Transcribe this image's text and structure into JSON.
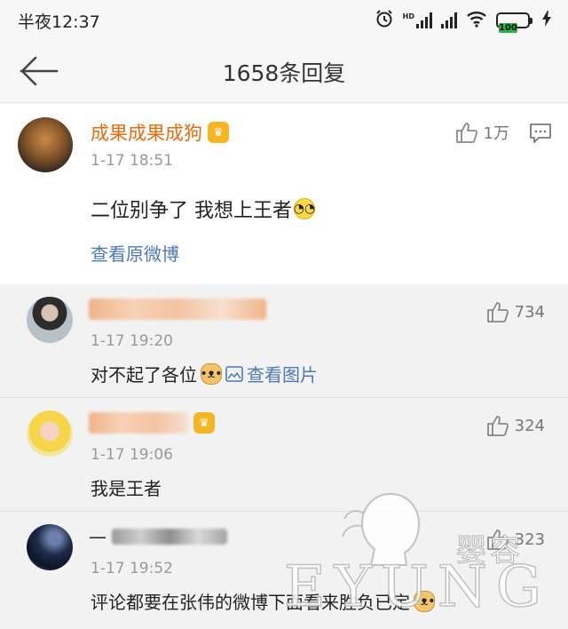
{
  "status_bar": {
    "time": "半夜12:37",
    "battery": "100",
    "network": "HD"
  },
  "header": {
    "title": "1658条回复"
  },
  "root_comment": {
    "user_name": "成果成果成狗",
    "time": "1-17 18:51",
    "text": "二位别争了 我想上王者",
    "likes": "1万",
    "view_original": "查看原微博"
  },
  "replies": [
    {
      "time": "1-17 19:20",
      "text": "对不起了各位",
      "likes": "734",
      "picture_link": "查看图片"
    },
    {
      "time": "1-17 19:06",
      "text": "我是王者",
      "likes": "324"
    },
    {
      "time": "1-17 19:52",
      "text": "评论都要在张伟的微博下面看来胜负已定",
      "likes": "323"
    }
  ],
  "watermark": {
    "letters": "EYUNG",
    "cn": "婴容"
  },
  "colors": {
    "name_orange": "#e86b0b",
    "link_blue": "#4d7ab5",
    "battery_green": "#2bb24c"
  }
}
